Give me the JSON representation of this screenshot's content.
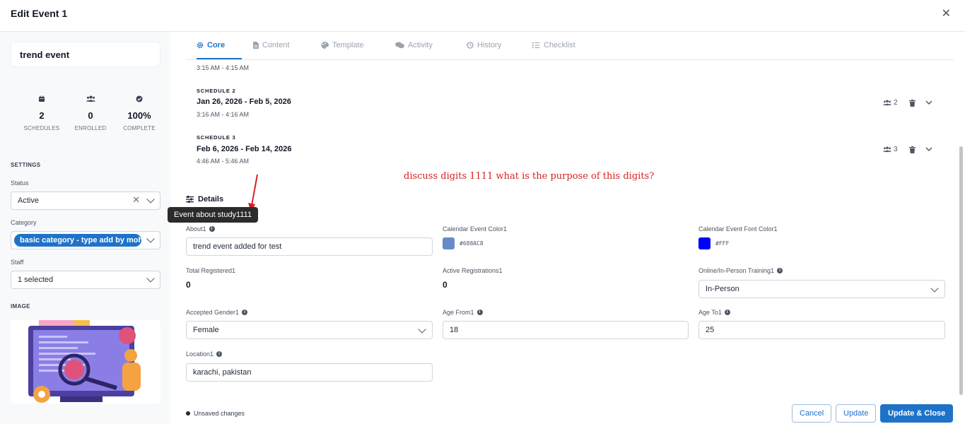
{
  "dialog": {
    "title": "Edit Event 1"
  },
  "sidebar": {
    "event_name": "trend event",
    "stats": [
      {
        "icon": "calendar-icon",
        "value": "2",
        "label": "SCHEDULES"
      },
      {
        "icon": "users-icon",
        "value": "0",
        "label": "ENROLLED"
      },
      {
        "icon": "check-circle-icon",
        "value": "100%",
        "label": "COMPLETE"
      }
    ],
    "settings_heading": "SETTINGS",
    "status_label": "Status",
    "status_value": "Active",
    "category_label": "Category",
    "category_value": "basic category - type add by mohan",
    "staff_label": "Staff",
    "staff_value": "1 selected",
    "image_heading": "IMAGE"
  },
  "tabs": [
    {
      "label": "Core",
      "icon": "gear-icon",
      "active": true
    },
    {
      "label": "Content",
      "icon": "document-icon",
      "active": false
    },
    {
      "label": "Template",
      "icon": "palette-icon",
      "active": false
    },
    {
      "label": "Activity",
      "icon": "chat-icon",
      "active": false
    },
    {
      "label": "History",
      "icon": "history-icon",
      "active": false
    },
    {
      "label": "Checklist",
      "icon": "checklist-icon",
      "active": false
    }
  ],
  "schedules": {
    "prev_time": "3:15 AM - 4:15 AM",
    "items": [
      {
        "label": "SCHEDULE 2",
        "dates": "Jan 26, 2026 - Feb 5, 2026",
        "time": "3:16 AM - 4:16 AM",
        "count": "2"
      },
      {
        "label": "SCHEDULE 3",
        "dates": "Feb 6, 2026 - Feb 14, 2026",
        "time": "4:46 AM - 5:46 AM",
        "count": "3"
      }
    ]
  },
  "annotation": "discuss digits 1111 what is the purpose of this digits?",
  "details": {
    "heading": "Details",
    "tooltip": "Event about study1111",
    "about_label": "About1",
    "about_value": "trend event added for test",
    "cal_color_label": "Calendar Event Color1",
    "cal_color_hex": "#688AC8",
    "cal_font_label": "Calendar Event Font Color1",
    "cal_font_hex": "#FFF",
    "cal_font_swatch": "#0000ff",
    "total_reg_label": "Total Registered1",
    "total_reg_value": "0",
    "active_reg_label": "Active Registrations1",
    "active_reg_value": "0",
    "training_label": "Online/In-Person Training1",
    "training_value": "In-Person",
    "gender_label": "Accepted Gender1",
    "gender_value": "Female",
    "age_from_label": "Age From1",
    "age_from_value": "18",
    "age_to_label": "Age To1",
    "age_to_value": "25",
    "location_label": "Location1",
    "location_value": "karachi, pakistan"
  },
  "footer": {
    "status": "Unsaved changes",
    "cancel": "Cancel",
    "update": "Update",
    "update_close": "Update & Close"
  },
  "colors": {
    "accent": "#1e73c9",
    "annotation": "#d62222"
  }
}
